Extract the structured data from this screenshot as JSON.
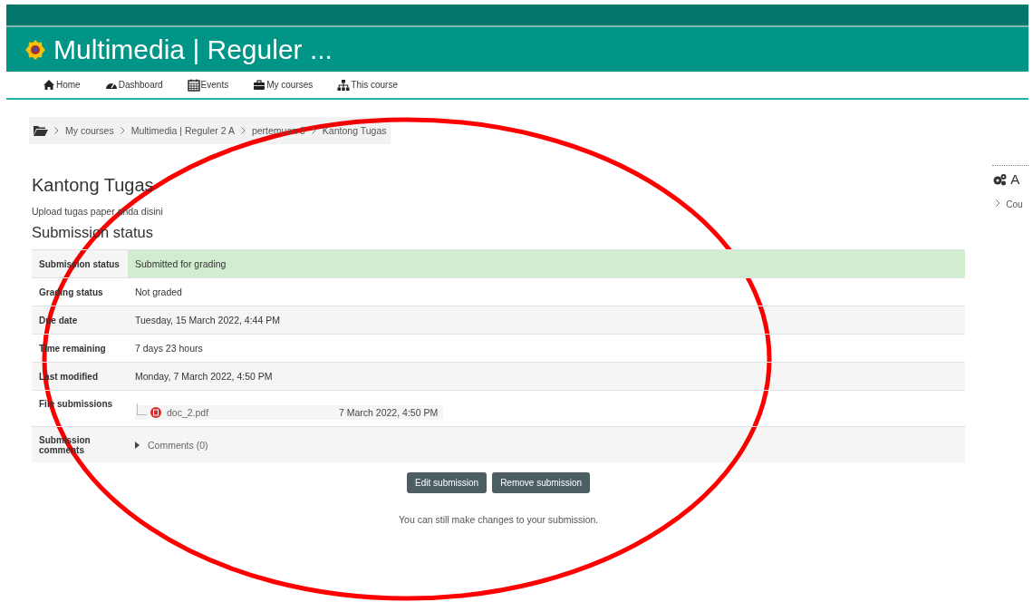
{
  "header": {
    "title": "Multimedia | Reguler ..."
  },
  "nav": [
    {
      "label": "Home"
    },
    {
      "label": "Dashboard"
    },
    {
      "label": "Events"
    },
    {
      "label": "My courses"
    },
    {
      "label": "This course"
    }
  ],
  "breadcrumb": [
    "My courses",
    "Multimedia | Reguler 2 A",
    "pertemuan 3",
    "Kantong Tugas"
  ],
  "page_title": "Kantong Tugas",
  "description": "Upload tugas paper anda disini",
  "section_title": "Submission status",
  "rows": [
    {
      "kind": "text",
      "label": "Submission status",
      "value": "Submitted for grading",
      "success": true
    },
    {
      "kind": "text",
      "label": "Grading status",
      "value": "Not graded",
      "success": false
    },
    {
      "kind": "text",
      "label": "Due date",
      "value": "Tuesday, 15 March 2022, 4:44 PM",
      "success": false
    },
    {
      "kind": "text",
      "label": "Time remaining",
      "value": "7 days 23 hours",
      "success": false
    },
    {
      "kind": "text",
      "label": "Last modified",
      "value": "Monday, 7 March 2022, 4:50 PM",
      "success": false
    },
    {
      "kind": "file",
      "label": "File submissions",
      "file_name": "doc_2.pdf",
      "file_date": "7 March 2022, 4:50 PM",
      "success": false
    },
    {
      "kind": "comments",
      "label": "Submission comments",
      "link": "Comments (0)",
      "success": false
    }
  ],
  "buttons": [
    "Edit submission",
    "Remove submission"
  ],
  "note": "You can still make changes to your submission.",
  "side_block": {
    "title": "A",
    "items": [
      "Cou"
    ]
  },
  "annotations": [
    {
      "kind": "ellipse"
    }
  ]
}
